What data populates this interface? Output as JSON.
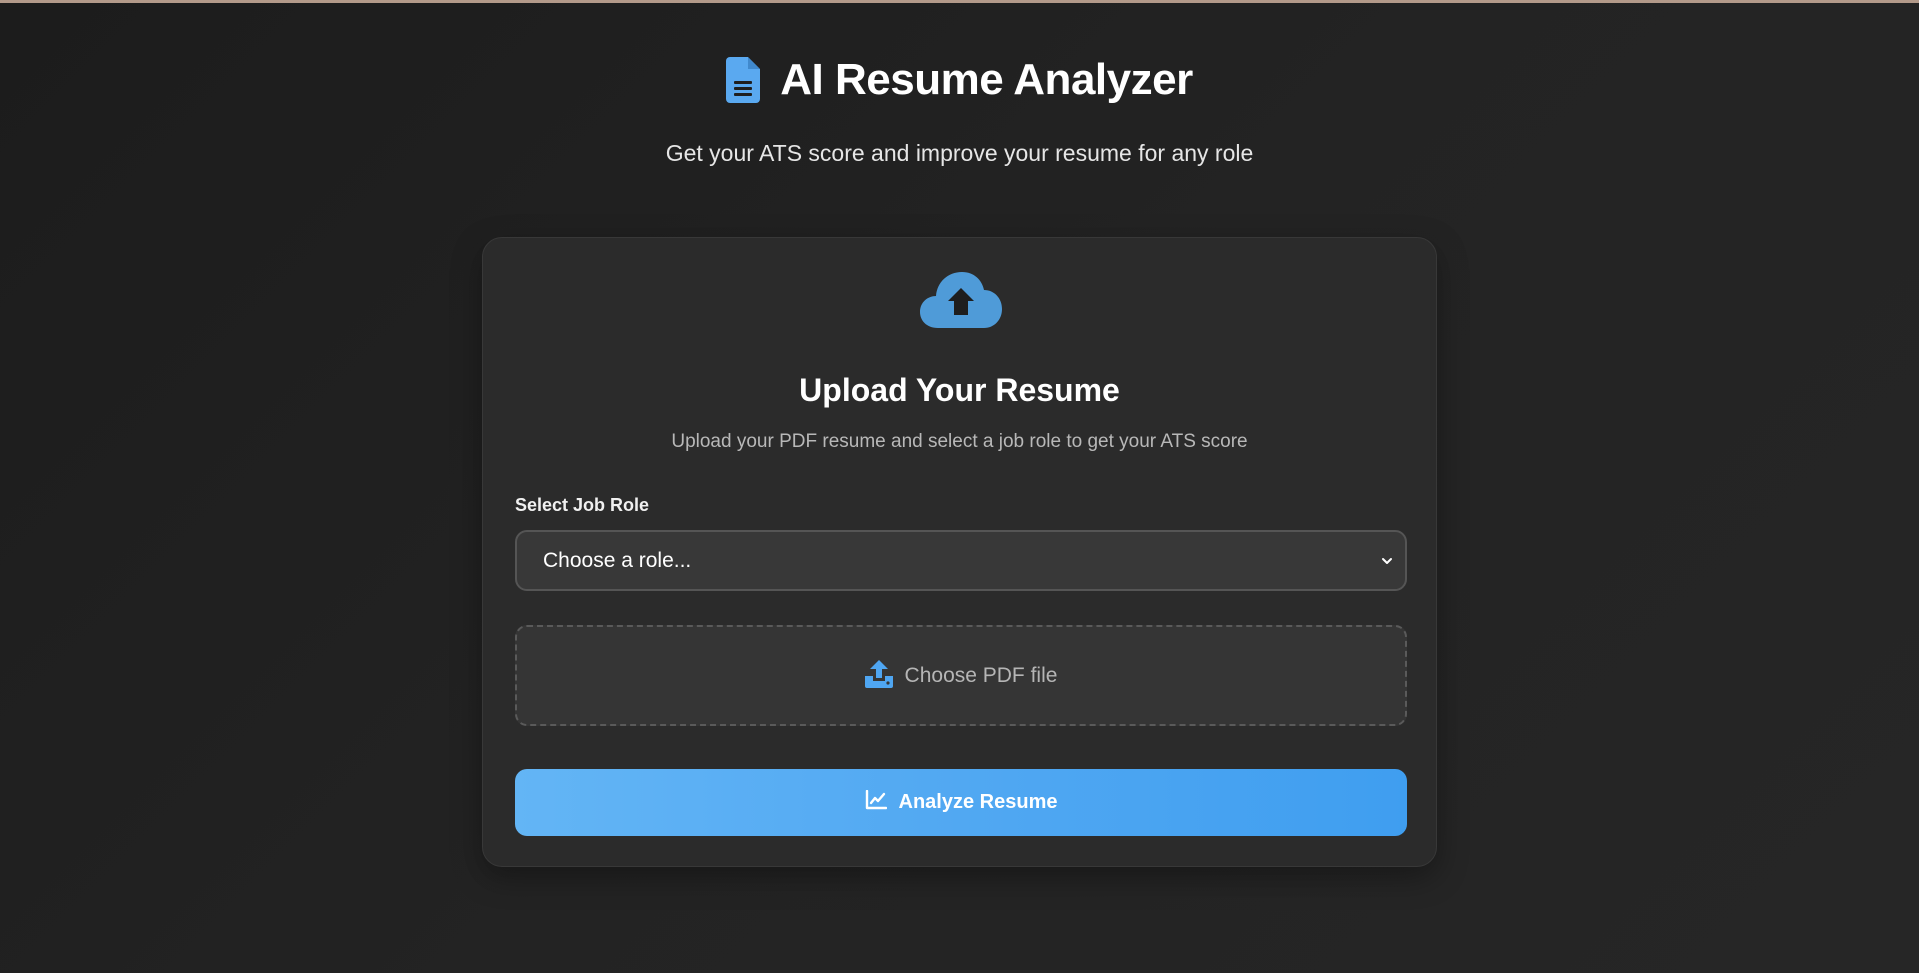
{
  "header": {
    "title": "AI Resume Analyzer",
    "subtitle": "Get your ATS score and improve your resume for any role",
    "icon": "file-document-icon"
  },
  "upload_card": {
    "icon": "cloud-upload-icon",
    "title": "Upload Your Resume",
    "description": "Upload your PDF resume and select a job role to get your ATS score",
    "role_select": {
      "label": "Select Job Role",
      "selected": "Choose a role..."
    },
    "file_input": {
      "icon": "upload-icon",
      "label": "Choose PDF file"
    },
    "analyze_button": {
      "icon": "line-chart-icon",
      "label": "Analyze Resume"
    }
  },
  "colors": {
    "accent": "#4fa6f2",
    "background": "#1f1f1f",
    "card": "#2b2b2b"
  }
}
